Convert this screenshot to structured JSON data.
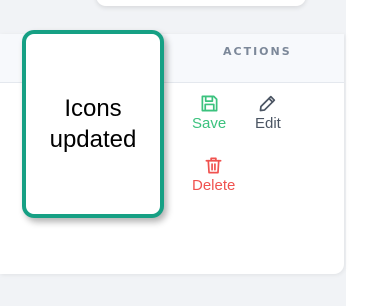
{
  "table": {
    "actions_header": "ACTIONS"
  },
  "row_actions": {
    "save": {
      "label": "Save",
      "icon": "floppy-disk-icon",
      "color": "#3bc27e"
    },
    "edit": {
      "label": "Edit",
      "icon": "pencil-icon",
      "color": "#4b5563"
    },
    "delete": {
      "label": "Delete",
      "icon": "trash-icon",
      "color": "#f0524f"
    }
  },
  "callout": {
    "text": "Icons updated",
    "border_color": "#16a084"
  }
}
